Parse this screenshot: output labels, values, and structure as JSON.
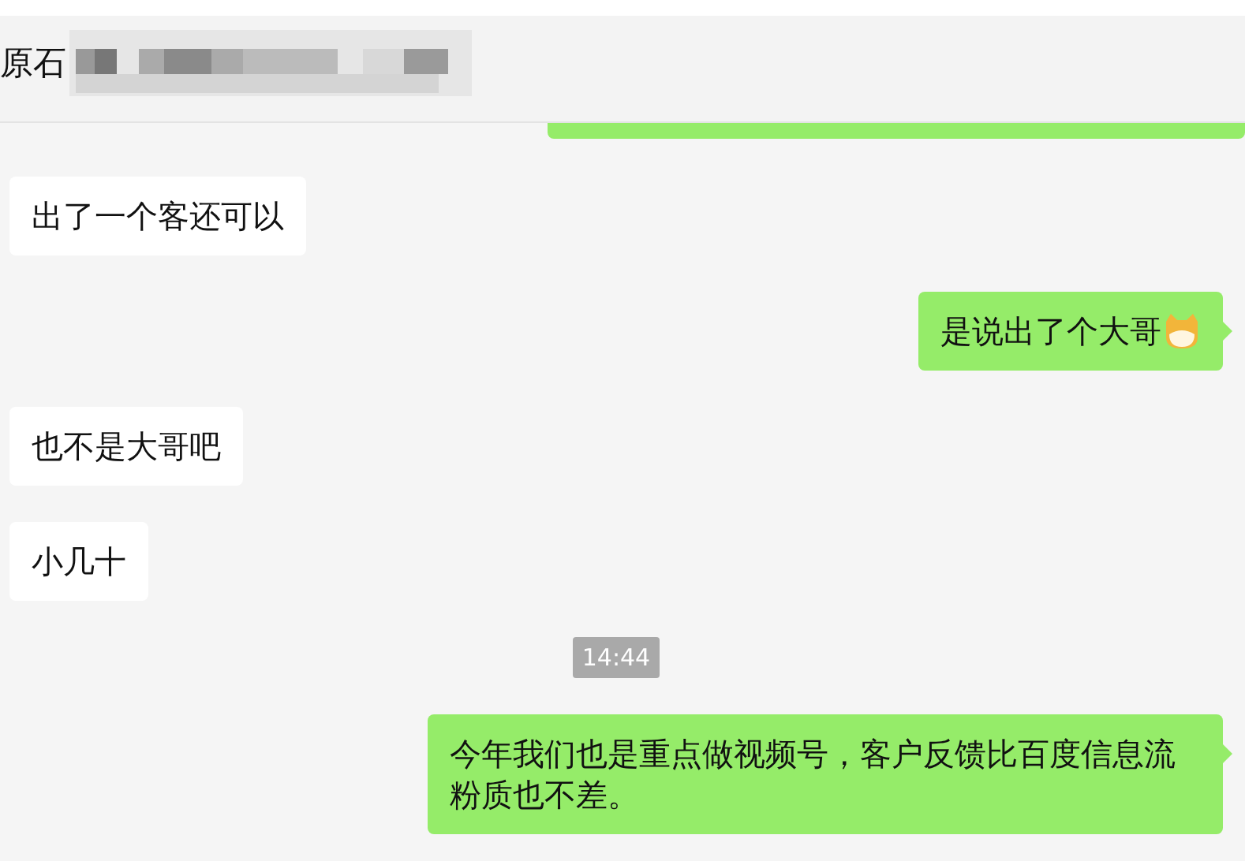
{
  "header": {
    "title": "原石"
  },
  "messages": [
    {
      "kind": "clipped",
      "outgoing": true
    },
    {
      "kind": "text",
      "outgoing": false,
      "text": "出了一个客还可以",
      "trailing_emoji": false
    },
    {
      "kind": "text",
      "outgoing": true,
      "text": "是说出了个大哥",
      "trailing_emoji": true
    },
    {
      "kind": "text",
      "outgoing": false,
      "text": "也不是大哥吧",
      "trailing_emoji": false
    },
    {
      "kind": "text",
      "outgoing": false,
      "text": "小几十",
      "trailing_emoji": false
    },
    {
      "kind": "time",
      "text": "14:44"
    },
    {
      "kind": "text",
      "outgoing": true,
      "text": "今年我们也是重点做视频号，客户反馈比百度信息流粉质也不差。",
      "trailing_emoji": false
    }
  ]
}
